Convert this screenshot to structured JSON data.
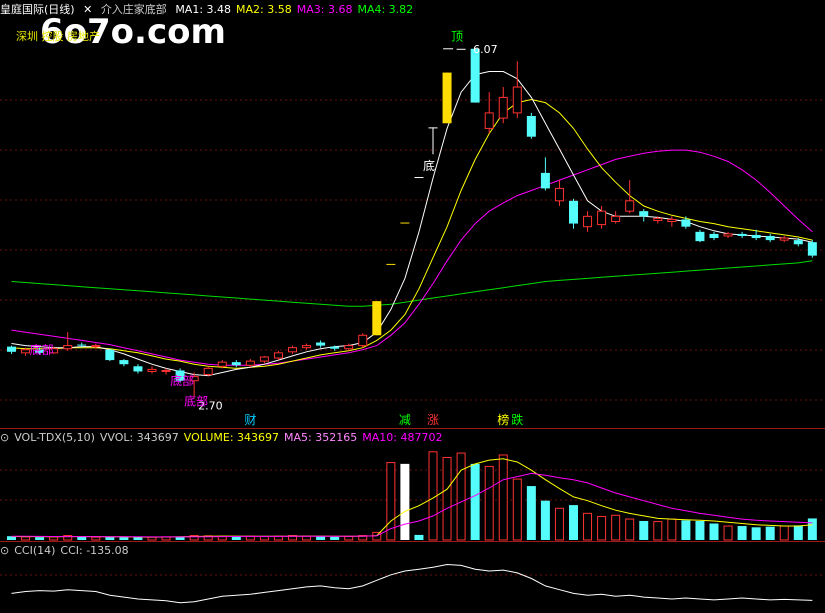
{
  "header": {
    "stock_name": "皇庭国际",
    "period": "(日线)",
    "indicator_name": "介入庄家底部",
    "ma_values": [
      {
        "label": "MA1: 3.48",
        "color": "#ffffff"
      },
      {
        "label": "MA2: 3.58",
        "color": "#ffff00"
      },
      {
        "label": "MA3: 3.68",
        "color": "#ff00ff"
      },
      {
        "label": "MA4: 3.82",
        "color": "#00ff00"
      }
    ]
  },
  "watermark": "6o7o.com",
  "notice_text": "深圳 控股 房地产",
  "main_chart": {
    "ylim": [
      2.5,
      6.3
    ],
    "high_label": "6.07",
    "low_label": "2.70",
    "candles": [
      {
        "o": 3.14,
        "c": 3.19,
        "h": 3.2,
        "l": 3.12,
        "col": "cyan"
      },
      {
        "o": 3.13,
        "c": 3.16,
        "h": 3.18,
        "l": 3.1,
        "col": "red"
      },
      {
        "o": 3.16,
        "c": 3.13,
        "h": 3.18,
        "l": 3.11,
        "col": "cyan"
      },
      {
        "o": 3.13,
        "c": 3.17,
        "h": 3.19,
        "l": 3.12,
        "col": "red"
      },
      {
        "o": 3.17,
        "c": 3.2,
        "h": 3.33,
        "l": 3.15,
        "col": "red"
      },
      {
        "o": 3.2,
        "c": 3.21,
        "h": 3.23,
        "l": 3.18,
        "col": "cyan"
      },
      {
        "o": 3.2,
        "c": 3.19,
        "h": 3.22,
        "l": 3.17,
        "col": "red"
      },
      {
        "o": 3.16,
        "c": 3.06,
        "h": 3.17,
        "l": 3.05,
        "col": "cyan"
      },
      {
        "o": 3.06,
        "c": 3.02,
        "h": 3.07,
        "l": 3.0,
        "col": "cyan"
      },
      {
        "o": 3.0,
        "c": 2.95,
        "h": 3.02,
        "l": 2.93,
        "col": "cyan"
      },
      {
        "o": 2.95,
        "c": 2.97,
        "h": 3.0,
        "l": 2.93,
        "col": "red"
      },
      {
        "o": 2.95,
        "c": 2.96,
        "h": 2.98,
        "l": 2.92,
        "col": "red"
      },
      {
        "o": 2.96,
        "c": 2.86,
        "h": 2.98,
        "l": 2.84,
        "col": "cyan"
      },
      {
        "o": 2.86,
        "c": 2.9,
        "h": 2.94,
        "l": 2.7,
        "col": "red"
      },
      {
        "o": 2.92,
        "c": 2.98,
        "h": 3.0,
        "l": 2.9,
        "col": "red"
      },
      {
        "o": 3.0,
        "c": 3.04,
        "h": 3.06,
        "l": 2.98,
        "col": "red"
      },
      {
        "o": 3.04,
        "c": 3.01,
        "h": 3.06,
        "l": 2.99,
        "col": "cyan"
      },
      {
        "o": 3.01,
        "c": 3.05,
        "h": 3.07,
        "l": 2.99,
        "col": "red"
      },
      {
        "o": 3.05,
        "c": 3.09,
        "h": 3.1,
        "l": 3.03,
        "col": "red"
      },
      {
        "o": 3.08,
        "c": 3.13,
        "h": 3.15,
        "l": 3.06,
        "col": "red"
      },
      {
        "o": 3.14,
        "c": 3.18,
        "h": 3.2,
        "l": 3.12,
        "col": "red"
      },
      {
        "o": 3.18,
        "c": 3.2,
        "h": 3.22,
        "l": 3.16,
        "col": "red"
      },
      {
        "o": 3.2,
        "c": 3.23,
        "h": 3.25,
        "l": 3.18,
        "col": "cyan"
      },
      {
        "o": 3.17,
        "c": 3.19,
        "h": 3.2,
        "l": 3.15,
        "col": "cyan"
      },
      {
        "o": 3.17,
        "c": 3.2,
        "h": 3.22,
        "l": 3.15,
        "col": "red"
      },
      {
        "o": 3.2,
        "c": 3.3,
        "h": 3.32,
        "l": 3.18,
        "col": "red"
      },
      {
        "o": 3.3,
        "c": 3.63,
        "h": 3.63,
        "l": 3.3,
        "col": "yellow"
      },
      {
        "o": 3.99,
        "c": 3.99,
        "h": 3.99,
        "l": 3.99,
        "col": "yellow"
      },
      {
        "o": 4.39,
        "c": 4.39,
        "h": 4.39,
        "l": 4.39,
        "col": "yellow"
      },
      {
        "o": 4.83,
        "c": 4.83,
        "h": 4.83,
        "l": 4.83,
        "col": "white"
      },
      {
        "o": 5.31,
        "c": 5.31,
        "h": 5.31,
        "l": 5.05,
        "col": "white"
      },
      {
        "o": 5.35,
        "c": 5.84,
        "h": 5.84,
        "l": 5.35,
        "col": "yellow"
      },
      {
        "o": 6.07,
        "c": 6.07,
        "h": 6.07,
        "l": 6.07,
        "col": "white"
      },
      {
        "o": 6.07,
        "c": 5.55,
        "h": 6.07,
        "l": 5.55,
        "col": "cyan"
      },
      {
        "o": 5.3,
        "c": 5.45,
        "h": 5.65,
        "l": 5.25,
        "col": "red"
      },
      {
        "o": 5.4,
        "c": 5.6,
        "h": 5.7,
        "l": 5.35,
        "col": "red"
      },
      {
        "o": 5.45,
        "c": 5.7,
        "h": 5.95,
        "l": 5.4,
        "col": "red"
      },
      {
        "o": 5.42,
        "c": 5.22,
        "h": 5.45,
        "l": 5.2,
        "col": "cyan"
      },
      {
        "o": 4.87,
        "c": 4.72,
        "h": 5.02,
        "l": 4.7,
        "col": "cyan"
      },
      {
        "o": 4.6,
        "c": 4.72,
        "h": 4.8,
        "l": 4.55,
        "col": "red"
      },
      {
        "o": 4.6,
        "c": 4.38,
        "h": 4.62,
        "l": 4.33,
        "col": "cyan"
      },
      {
        "o": 4.35,
        "c": 4.45,
        "h": 4.5,
        "l": 4.3,
        "col": "red"
      },
      {
        "o": 4.37,
        "c": 4.5,
        "h": 4.55,
        "l": 4.33,
        "col": "red"
      },
      {
        "o": 4.4,
        "c": 4.45,
        "h": 4.5,
        "l": 4.38,
        "col": "red"
      },
      {
        "o": 4.5,
        "c": 4.6,
        "h": 4.8,
        "l": 4.48,
        "col": "red"
      },
      {
        "o": 4.5,
        "c": 4.45,
        "h": 4.52,
        "l": 4.4,
        "col": "cyan"
      },
      {
        "o": 4.43,
        "c": 4.41,
        "h": 4.45,
        "l": 4.38,
        "col": "red"
      },
      {
        "o": 4.42,
        "c": 4.4,
        "h": 4.45,
        "l": 4.35,
        "col": "red"
      },
      {
        "o": 4.42,
        "c": 4.35,
        "h": 4.45,
        "l": 4.33,
        "col": "cyan"
      },
      {
        "o": 4.3,
        "c": 4.21,
        "h": 4.32,
        "l": 4.2,
        "col": "cyan"
      },
      {
        "o": 4.28,
        "c": 4.24,
        "h": 4.3,
        "l": 4.22,
        "col": "cyan"
      },
      {
        "o": 4.26,
        "c": 4.28,
        "h": 4.3,
        "l": 4.24,
        "col": "red"
      },
      {
        "o": 4.28,
        "c": 4.26,
        "h": 4.3,
        "l": 4.24,
        "col": "cyan"
      },
      {
        "o": 4.27,
        "c": 4.24,
        "h": 4.32,
        "l": 4.22,
        "col": "cyan"
      },
      {
        "o": 4.26,
        "c": 4.22,
        "h": 4.28,
        "l": 4.2,
        "col": "cyan"
      },
      {
        "o": 4.22,
        "c": 4.24,
        "h": 4.26,
        "l": 4.2,
        "col": "red"
      },
      {
        "o": 4.22,
        "c": 4.18,
        "h": 4.24,
        "l": 4.16,
        "col": "cyan"
      },
      {
        "o": 4.2,
        "c": 4.07,
        "h": 4.22,
        "l": 4.05,
        "col": "cyan"
      }
    ],
    "ma1": [
      3.22,
      3.2,
      3.19,
      3.18,
      3.18,
      3.19,
      3.19,
      3.16,
      3.12,
      3.07,
      3.02,
      2.98,
      2.95,
      2.92,
      2.91,
      2.94,
      2.97,
      2.99,
      3.02,
      3.06,
      3.1,
      3.14,
      3.17,
      3.19,
      3.2,
      3.23,
      3.33,
      3.55,
      3.85,
      4.3,
      4.82,
      5.3,
      5.65,
      5.82,
      5.85,
      5.85,
      5.78,
      5.6,
      5.35,
      5.1,
      4.85,
      4.6,
      4.5,
      4.45,
      4.45,
      4.45,
      4.44,
      4.42,
      4.4,
      4.35,
      4.31,
      4.28,
      4.27,
      4.26,
      4.25,
      4.24,
      4.23,
      4.2
    ],
    "ma2": [
      3.18,
      3.17,
      3.17,
      3.17,
      3.18,
      3.18,
      3.18,
      3.17,
      3.15,
      3.13,
      3.1,
      3.07,
      3.05,
      3.02,
      3.0,
      2.99,
      2.98,
      2.99,
      3.0,
      3.02,
      3.05,
      3.08,
      3.11,
      3.13,
      3.15,
      3.18,
      3.25,
      3.35,
      3.5,
      3.75,
      4.05,
      4.35,
      4.7,
      5.0,
      5.25,
      5.45,
      5.55,
      5.58,
      5.55,
      5.45,
      5.3,
      5.1,
      4.92,
      4.78,
      4.65,
      4.55,
      4.5,
      4.46,
      4.43,
      4.4,
      4.38,
      4.35,
      4.33,
      4.31,
      4.29,
      4.27,
      4.25,
      4.22
    ],
    "ma3": [
      3.35,
      3.33,
      3.31,
      3.29,
      3.27,
      3.25,
      3.23,
      3.21,
      3.18,
      3.15,
      3.12,
      3.09,
      3.06,
      3.04,
      3.02,
      3.01,
      3.01,
      3.01,
      3.02,
      3.03,
      3.05,
      3.07,
      3.09,
      3.11,
      3.13,
      3.16,
      3.2,
      3.3,
      3.42,
      3.6,
      3.8,
      4.02,
      4.22,
      4.38,
      4.5,
      4.58,
      4.65,
      4.7,
      4.75,
      4.8,
      4.85,
      4.9,
      4.95,
      5.0,
      5.03,
      5.06,
      5.08,
      5.09,
      5.09,
      5.07,
      5.03,
      4.98,
      4.9,
      4.8,
      4.68,
      4.55,
      4.42,
      4.3
    ],
    "ma4": [
      3.82,
      3.81,
      3.8,
      3.79,
      3.78,
      3.77,
      3.76,
      3.75,
      3.74,
      3.73,
      3.72,
      3.71,
      3.7,
      3.69,
      3.68,
      3.67,
      3.66,
      3.65,
      3.64,
      3.63,
      3.62,
      3.61,
      3.6,
      3.59,
      3.58,
      3.58,
      3.59,
      3.6,
      3.62,
      3.64,
      3.66,
      3.68,
      3.7,
      3.72,
      3.74,
      3.76,
      3.78,
      3.8,
      3.82,
      3.83,
      3.84,
      3.85,
      3.86,
      3.87,
      3.88,
      3.89,
      3.9,
      3.91,
      3.92,
      3.93,
      3.94,
      3.95,
      3.96,
      3.97,
      3.98,
      3.99,
      4.0,
      4.02
    ]
  },
  "signals": [
    {
      "text": "底部",
      "color": "#ff00ff",
      "candle": 2,
      "price": 3.12
    },
    {
      "text": "底部",
      "color": "#ff00ff",
      "candle": 12,
      "price": 2.82
    },
    {
      "text": "底部",
      "color": "#ff00ff",
      "candle": 13,
      "price": 2.62
    },
    {
      "text": "底",
      "color": "#ffffff",
      "candle": 30,
      "price": 4.9
    },
    {
      "text": "顶",
      "color": "#00ff00",
      "candle": 32,
      "price": 6.15
    }
  ],
  "bottom_markers": [
    {
      "text": "财",
      "color": "#00ccff",
      "candle": 17
    },
    {
      "text": "减",
      "color": "#00ff00",
      "candle": 28
    },
    {
      "text": "涨",
      "color": "#ff3333",
      "candle": 30
    },
    {
      "text": "榜",
      "color": "#ffff00",
      "candle": 35
    },
    {
      "text": "跌",
      "color": "#00ff00",
      "candle": 36
    }
  ],
  "volume": {
    "header": [
      {
        "label": "VOL-TDX(5,10)",
        "color": "#cccccc"
      },
      {
        "label": "VVOL: 343697",
        "color": "#cccccc"
      },
      {
        "label": "VOLUME: 343697",
        "color": "#ffff00"
      },
      {
        "label": "MA5: 352165",
        "color": "#ff88ff"
      },
      {
        "label": "MA10: 487702",
        "color": "#ff00ff"
      }
    ],
    "max": 1450000,
    "bars": [
      60000,
      50000,
      45000,
      50000,
      70000,
      55000,
      45000,
      50000,
      45000,
      40000,
      45000,
      50000,
      55000,
      70000,
      65000,
      60000,
      55000,
      60000,
      55000,
      60000,
      70000,
      60000,
      55000,
      50000,
      55000,
      70000,
      120000,
      1220000,
      1200000,
      80000,
      1390000,
      1300000,
      1370000,
      1200000,
      1160000,
      1340000,
      960000,
      850000,
      620000,
      500000,
      550000,
      420000,
      370000,
      390000,
      330000,
      300000,
      290000,
      330000,
      310000,
      300000,
      260000,
      220000,
      220000,
      200000,
      210000,
      220000,
      230000,
      340000
    ],
    "colors": [
      "c",
      "r",
      "c",
      "r",
      "r",
      "c",
      "r",
      "c",
      "c",
      "c",
      "r",
      "r",
      "c",
      "r",
      "r",
      "r",
      "c",
      "r",
      "r",
      "r",
      "r",
      "r",
      "c",
      "c",
      "r",
      "r",
      "r",
      "r",
      "w",
      "c",
      "r",
      "r",
      "r",
      "c",
      "r",
      "r",
      "r",
      "c",
      "c",
      "r",
      "c",
      "r",
      "r",
      "r",
      "r",
      "c",
      "r",
      "r",
      "c",
      "c",
      "c",
      "r",
      "c",
      "c",
      "c",
      "r",
      "c",
      "c"
    ],
    "ma5": [
      55000,
      54000,
      53000,
      52000,
      54000,
      55000,
      53000,
      51000,
      50000,
      48000,
      46000,
      47000,
      50000,
      55000,
      60000,
      62000,
      62000,
      60000,
      58000,
      58000,
      60000,
      62000,
      61000,
      59000,
      58000,
      60000,
      70000,
      300000,
      450000,
      540000,
      660000,
      800000,
      1100000,
      1200000,
      1260000,
      1280000,
      1230000,
      1100000,
      950000,
      810000,
      680000,
      620000,
      540000,
      470000,
      420000,
      380000,
      340000,
      330000,
      320000,
      310000,
      300000,
      280000,
      260000,
      240000,
      230000,
      220000,
      220000,
      240000
    ],
    "ma10": [
      60000,
      58000,
      56000,
      55000,
      54000,
      54000,
      53000,
      52000,
      51000,
      50000,
      49000,
      49000,
      49000,
      50000,
      52000,
      54000,
      56000,
      57000,
      57000,
      57000,
      58000,
      59000,
      60000,
      60000,
      60000,
      61000,
      65000,
      180000,
      250000,
      300000,
      380000,
      500000,
      600000,
      700000,
      820000,
      950000,
      1000000,
      1050000,
      1020000,
      980000,
      950000,
      900000,
      820000,
      740000,
      680000,
      620000,
      560000,
      500000,
      460000,
      420000,
      390000,
      360000,
      330000,
      310000,
      300000,
      290000,
      280000,
      270000
    ]
  },
  "cci": {
    "label": "CCI(14)",
    "value_label": "CCI: -135.08",
    "values": [
      -60,
      -40,
      -30,
      -35,
      -20,
      -30,
      -40,
      -80,
      -100,
      -120,
      -130,
      -140,
      -160,
      -150,
      -120,
      -90,
      -80,
      -70,
      -50,
      -30,
      -10,
      10,
      20,
      0,
      -10,
      20,
      80,
      140,
      180,
      200,
      220,
      250,
      240,
      200,
      180,
      190,
      160,
      100,
      20,
      -20,
      -60,
      -80,
      -70,
      -90,
      -80,
      -100,
      -110,
      -120,
      -110,
      -120,
      -130,
      -120,
      -110,
      -120,
      -130,
      -125,
      -130,
      -135
    ],
    "ylim": [
      -260,
      320
    ]
  }
}
